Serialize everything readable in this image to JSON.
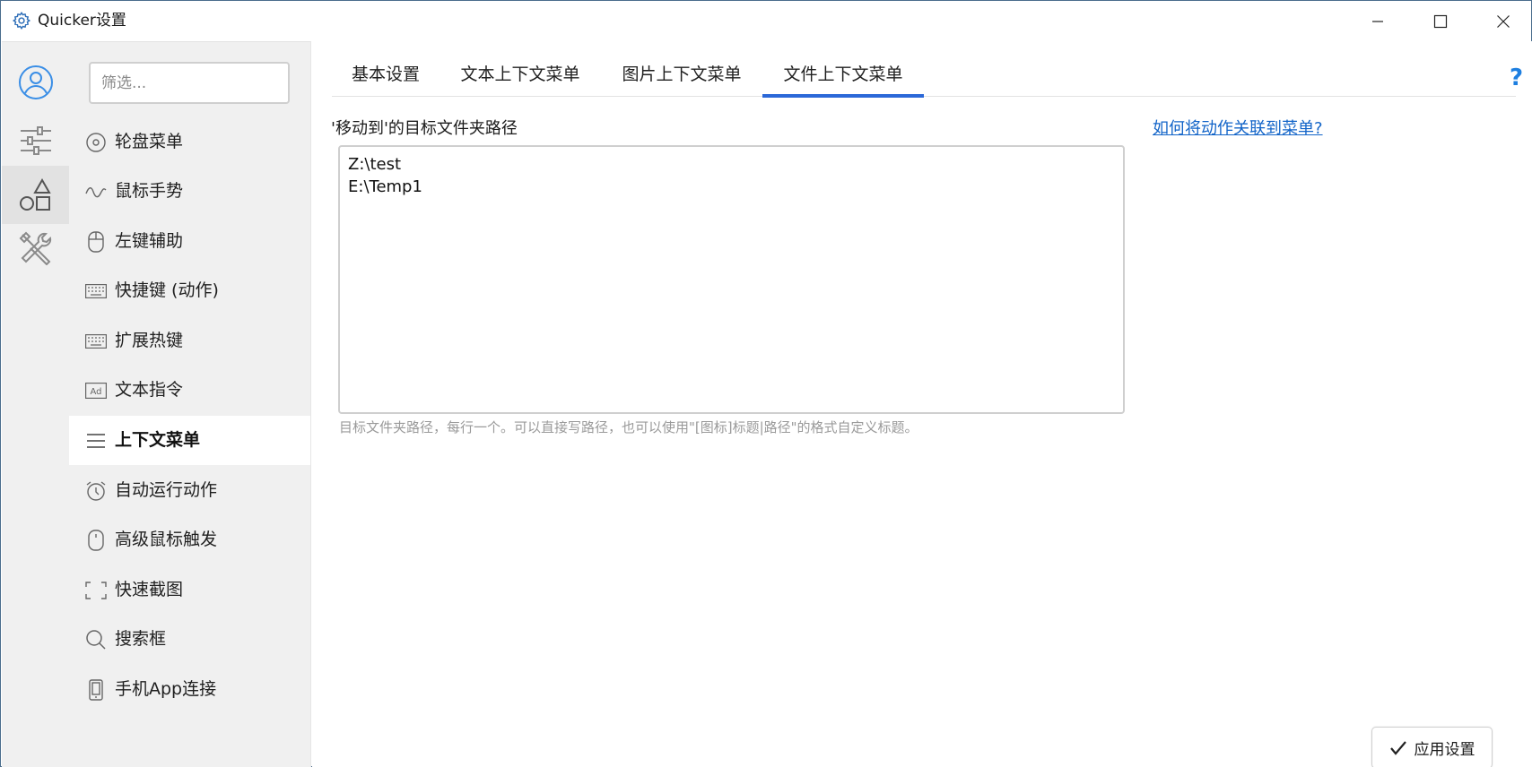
{
  "window": {
    "title": "Quicker设置",
    "controls": {
      "minimize": "minimize",
      "maximize": "maximize",
      "close": "close"
    }
  },
  "rail": [
    {
      "name": "account",
      "icon": "user-circle-icon"
    },
    {
      "name": "settings",
      "icon": "sliders-icon"
    },
    {
      "name": "features",
      "icon": "shapes-icon",
      "active": true
    },
    {
      "name": "tools",
      "icon": "tools-icon"
    }
  ],
  "filter": {
    "placeholder": "筛选..."
  },
  "nav": {
    "items": [
      {
        "label": "轮盘菜单",
        "icon": "disc-icon"
      },
      {
        "label": "鼠标手势",
        "icon": "wave-icon"
      },
      {
        "label": "左键辅助",
        "icon": "mouse-icon"
      },
      {
        "label": "快捷键 (动作)",
        "icon": "keyboard-icon"
      },
      {
        "label": "扩展热键",
        "icon": "keyboard-icon"
      },
      {
        "label": "文本指令",
        "icon": "ad-icon"
      },
      {
        "label": "上下文菜单",
        "icon": "menu-lines-icon",
        "active": true
      },
      {
        "label": "自动运行动作",
        "icon": "alarm-clock-icon"
      },
      {
        "label": "高级鼠标触发",
        "icon": "mouse-icon"
      },
      {
        "label": "快速截图",
        "icon": "screenshot-frame-icon"
      },
      {
        "label": "搜索框",
        "icon": "search-icon"
      },
      {
        "label": "手机App连接",
        "icon": "phone-icon"
      }
    ]
  },
  "tabs": [
    {
      "label": "基本设置"
    },
    {
      "label": "文本上下文菜单"
    },
    {
      "label": "图片上下文菜单"
    },
    {
      "label": "文件上下文菜单",
      "active": true
    }
  ],
  "help": {
    "label": "?"
  },
  "content": {
    "field_label": "'移动到'的目标文件夹路径",
    "help_link": "如何将动作关联到菜单?",
    "paths_value": "Z:\\test\nE:\\Temp1",
    "hint": "目标文件夹路径，每行一个。可以直接写路径，也可以使用\"[图标]标题|路径\"的格式自定义标题。"
  },
  "footer": {
    "apply_label": "应用设置"
  },
  "colors": {
    "accent": "#2b68d8",
    "link": "#1264c8",
    "help": "#1e7fe0",
    "sidebar_bg": "#f0f0f0",
    "icon_blue": "#3a8ee6"
  }
}
